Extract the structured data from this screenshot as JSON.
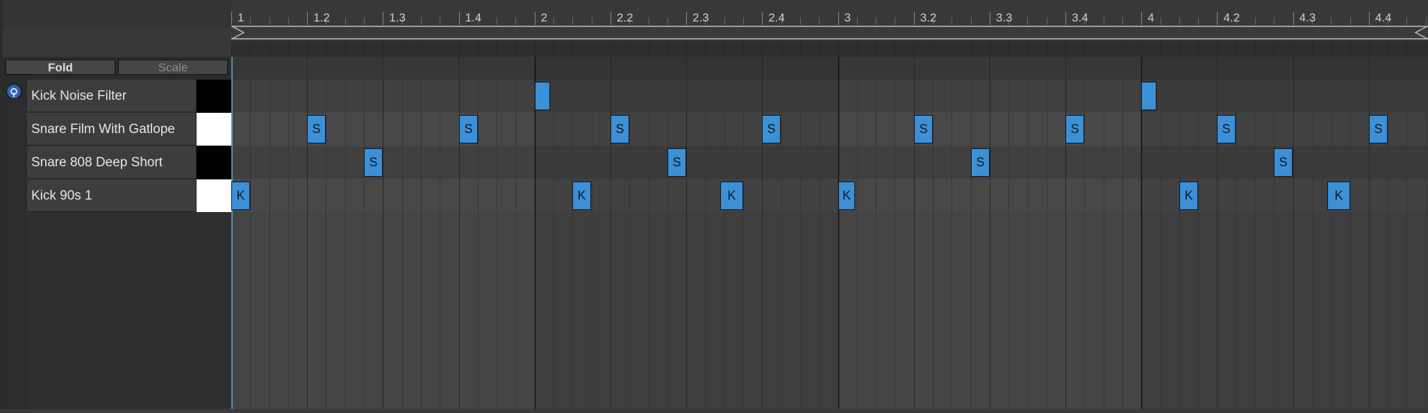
{
  "toolbar": {
    "fold_label": "Fold",
    "scale_label": "Scale"
  },
  "tracks": [
    {
      "name": "Kick Noise Filter",
      "swatch": "#000000"
    },
    {
      "name": "Snare Film With Gatlope",
      "swatch": "#ffffff"
    },
    {
      "name": "Snare 808 Deep Short",
      "swatch": "#000000"
    },
    {
      "name": "Kick 90s 1",
      "swatch": "#ffffff"
    }
  ],
  "ruler": {
    "labels": [
      "1",
      "1.2",
      "1.3",
      "1.4",
      "2",
      "2.2",
      "2.3",
      "2.4",
      "3",
      "3.2",
      "3.3",
      "3.4",
      "4",
      "4.2",
      "4.3",
      "4.4"
    ]
  },
  "clip": {
    "length_beats": 16,
    "visible_beats": 15.78
  },
  "notes": [
    {
      "track": 0,
      "start": 4.0,
      "length": 0.2,
      "label": ""
    },
    {
      "track": 0,
      "start": 12.0,
      "length": 0.2,
      "label": ""
    },
    {
      "track": 1,
      "start": 1.0,
      "length": 0.25,
      "label": "S"
    },
    {
      "track": 1,
      "start": 3.0,
      "length": 0.25,
      "label": "S"
    },
    {
      "track": 1,
      "start": 5.0,
      "length": 0.25,
      "label": "S"
    },
    {
      "track": 1,
      "start": 7.0,
      "length": 0.25,
      "label": "S"
    },
    {
      "track": 1,
      "start": 9.0,
      "length": 0.25,
      "label": "S"
    },
    {
      "track": 1,
      "start": 11.0,
      "length": 0.25,
      "label": "S"
    },
    {
      "track": 1,
      "start": 13.0,
      "length": 0.25,
      "label": "S"
    },
    {
      "track": 1,
      "start": 15.0,
      "length": 0.25,
      "label": "S"
    },
    {
      "track": 2,
      "start": 1.75,
      "length": 0.25,
      "label": "S"
    },
    {
      "track": 2,
      "start": 5.75,
      "length": 0.25,
      "label": "S"
    },
    {
      "track": 2,
      "start": 9.75,
      "length": 0.25,
      "label": "S"
    },
    {
      "track": 2,
      "start": 13.75,
      "length": 0.25,
      "label": "S"
    },
    {
      "track": 3,
      "start": 0.0,
      "length": 0.25,
      "label": "K"
    },
    {
      "track": 3,
      "start": 4.5,
      "length": 0.25,
      "label": "K"
    },
    {
      "track": 3,
      "start": 6.45,
      "length": 0.3,
      "label": "K"
    },
    {
      "track": 3,
      "start": 8.0,
      "length": 0.22,
      "label": "K"
    },
    {
      "track": 3,
      "start": 12.5,
      "length": 0.25,
      "label": "K"
    },
    {
      "track": 3,
      "start": 14.45,
      "length": 0.3,
      "label": "K"
    }
  ],
  "colors": {
    "note": "#3d8fd6",
    "playhead": "#5fb8e6",
    "accent": "#2f62b0"
  },
  "icons": {
    "focus": "target-focus-icon",
    "loop_start": "triangle-right-icon",
    "loop_end": "triangle-left-icon"
  }
}
